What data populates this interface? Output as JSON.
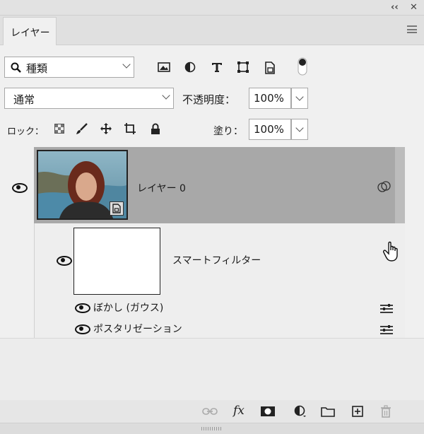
{
  "panel": {
    "tab_label": "レイヤー",
    "collapse_glyph": "‹‹",
    "close_glyph": "✕"
  },
  "filter": {
    "kind_label": "種類"
  },
  "blend": {
    "mode": "通常",
    "opacity_label": "不透明度：",
    "opacity_value": "100%"
  },
  "lock": {
    "label": "ロック：",
    "fill_label": "塗り：",
    "fill_value": "100%"
  },
  "layers": [
    {
      "name": "レイヤー 0",
      "smart_filters_label": "スマートフィルター",
      "filters": [
        "ぼかし (ガウス)",
        "ポスタリゼーション"
      ]
    }
  ],
  "footer": {
    "fx_label": "fx"
  },
  "colors": {
    "selected_row": "#a8a8a8",
    "panel_bg": "#f0f0f0"
  }
}
